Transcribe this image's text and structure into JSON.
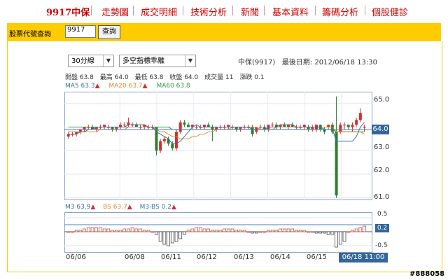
{
  "nav": {
    "items": [
      "9917中保",
      "走勢圖",
      "成交明細",
      "技術分析",
      "新聞",
      "基本資料",
      "籌碼分析",
      "個股健診"
    ]
  },
  "query": {
    "label": "股票代號查詢",
    "value": "9917",
    "button": "查詢"
  },
  "selectors": {
    "period": "30分線",
    "indicator": "多空指標乖離"
  },
  "stock": {
    "name_code": "中保(9917)",
    "last_date_label": "最後日期:",
    "last_date": "2012/06/18 13:30"
  },
  "quote": {
    "open": "開盤 63.8",
    "high": "最高 64.0",
    "low": "最低 63.8",
    "close": "收盤 64.0",
    "volume": "成交量 11",
    "change": "漲跌 0.1"
  },
  "ma": {
    "ma5": "MA5 63.3",
    "ma20": "MA20 63.7",
    "ma60": "MA60 63.8",
    "ma5_arrow": "▲",
    "ma20_arrow": "▲",
    "ma60_arrow": ""
  },
  "indicators": {
    "m3": "M3 63.9",
    "bs": "BS 63.7",
    "m3bs": "M3-BS 0.2",
    "m3_arrow": "▲",
    "bs_arrow": "▲",
    "m3bs_arrow": "▲"
  },
  "price_axis": [
    "65.0",
    "64.0",
    "63.0",
    "62.0",
    "61.0"
  ],
  "current_price": "64.0",
  "sub_axis": [
    "0.5",
    "0.2",
    "-0.5"
  ],
  "current_indicator": "0.2",
  "x_axis": [
    "06/06",
    "06/08",
    "06/11",
    "06/12",
    "06/13",
    "06/14",
    "06/15"
  ],
  "current_time": "06/18 11:00",
  "watermark": "#888058",
  "colors": {
    "up": "#d32f2f",
    "down": "#2e7d32",
    "ma5": "#3b6ea8",
    "ma20": "#e08a2c",
    "ma60": "#2e9a3e",
    "nav": "#cc0000",
    "bar": "#ffcc00"
  },
  "chart_data": {
    "type": "candlestick",
    "ylim": [
      60.9,
      65.5
    ],
    "candles": [
      [
        63.6,
        63.8,
        63.5,
        63.7
      ],
      [
        63.7,
        63.8,
        63.6,
        63.7
      ],
      [
        63.7,
        63.8,
        63.6,
        63.8
      ],
      [
        63.8,
        63.9,
        63.7,
        63.9
      ],
      [
        63.9,
        64.0,
        63.8,
        64.0
      ],
      [
        64.0,
        64.1,
        63.9,
        64.0
      ],
      [
        64.0,
        64.1,
        63.9,
        63.9
      ],
      [
        63.9,
        64.0,
        63.8,
        64.0
      ],
      [
        64.0,
        64.1,
        63.9,
        64.0
      ],
      [
        64.0,
        64.1,
        63.9,
        64.1
      ],
      [
        64.0,
        64.1,
        63.9,
        64.0
      ],
      [
        64.0,
        64.0,
        63.8,
        63.9
      ],
      [
        63.9,
        64.0,
        63.8,
        64.0
      ],
      [
        64.0,
        64.2,
        63.9,
        64.1
      ],
      [
        64.1,
        64.2,
        64.0,
        64.1
      ],
      [
        64.1,
        64.4,
        64.0,
        64.2
      ],
      [
        64.1,
        64.2,
        64.0,
        64.1
      ],
      [
        64.1,
        64.2,
        64.0,
        64.0
      ],
      [
        64.0,
        64.1,
        63.9,
        64.0
      ],
      [
        64.0,
        64.1,
        63.9,
        64.1
      ],
      [
        64.0,
        64.1,
        63.9,
        64.0
      ],
      [
        64.0,
        64.1,
        63.9,
        64.0
      ],
      [
        64.0,
        64.0,
        62.8,
        63.0
      ],
      [
        63.0,
        63.5,
        62.9,
        63.4
      ],
      [
        63.4,
        63.6,
        63.3,
        63.5
      ],
      [
        63.5,
        63.6,
        63.2,
        63.3
      ],
      [
        63.3,
        63.4,
        63.0,
        63.1
      ],
      [
        63.1,
        63.9,
        63.0,
        63.8
      ],
      [
        63.8,
        64.3,
        63.7,
        64.2
      ],
      [
        64.2,
        64.3,
        64.0,
        64.1
      ],
      [
        64.1,
        64.2,
        64.0,
        64.0
      ],
      [
        64.0,
        64.1,
        63.9,
        64.1
      ],
      [
        64.0,
        64.1,
        63.9,
        64.0
      ],
      [
        64.0,
        64.1,
        63.9,
        64.0
      ],
      [
        64.0,
        64.1,
        63.9,
        64.1
      ],
      [
        64.1,
        64.2,
        64.0,
        64.0
      ],
      [
        64.0,
        64.1,
        63.4,
        63.9
      ],
      [
        63.9,
        64.0,
        63.8,
        64.0
      ],
      [
        64.0,
        64.1,
        63.9,
        64.0
      ],
      [
        64.0,
        64.1,
        63.9,
        64.0
      ],
      [
        64.0,
        64.1,
        63.9,
        64.1
      ],
      [
        64.0,
        64.1,
        63.9,
        64.0
      ],
      [
        64.0,
        64.0,
        63.8,
        63.9
      ],
      [
        63.9,
        64.0,
        63.8,
        64.0
      ],
      [
        64.0,
        64.1,
        63.9,
        64.0
      ],
      [
        64.0,
        64.1,
        63.9,
        64.0
      ],
      [
        64.0,
        64.1,
        63.6,
        63.7
      ],
      [
        63.8,
        64.0,
        63.7,
        64.0
      ],
      [
        64.0,
        64.1,
        63.9,
        64.0
      ],
      [
        64.0,
        64.1,
        63.8,
        63.9
      ],
      [
        63.9,
        64.1,
        63.8,
        64.1
      ],
      [
        64.1,
        64.2,
        64.0,
        64.1
      ],
      [
        64.1,
        64.2,
        63.9,
        64.0
      ],
      [
        64.0,
        64.1,
        63.9,
        64.1
      ],
      [
        64.1,
        64.2,
        64.0,
        64.0
      ],
      [
        64.0,
        64.1,
        63.9,
        64.1
      ],
      [
        64.1,
        64.2,
        64.0,
        64.0
      ],
      [
        64.0,
        64.1,
        63.9,
        64.0
      ],
      [
        64.0,
        64.1,
        63.9,
        64.0
      ],
      [
        64.0,
        64.1,
        63.9,
        64.1
      ],
      [
        64.0,
        64.1,
        63.8,
        63.9
      ],
      [
        63.9,
        64.1,
        63.8,
        64.0
      ],
      [
        63.9,
        64.1,
        63.8,
        64.1
      ],
      [
        64.1,
        64.1,
        63.8,
        63.9
      ],
      [
        63.9,
        64.0,
        63.7,
        63.8
      ],
      [
        64.0,
        64.1,
        63.9,
        64.1
      ],
      [
        64.1,
        64.2,
        63.7,
        63.8
      ],
      [
        63.8,
        65.3,
        61.0,
        61.1
      ],
      [
        63.8,
        64.2,
        63.7,
        64.1
      ],
      [
        64.1,
        64.2,
        63.9,
        64.1
      ],
      [
        64.1,
        64.1,
        63.9,
        64.0
      ],
      [
        64.0,
        64.2,
        63.8,
        64.1
      ],
      [
        64.1,
        64.4,
        64.0,
        64.3
      ],
      [
        64.3,
        64.8,
        64.2,
        64.6
      ],
      [
        64.0,
        64.1,
        63.8,
        64.0
      ]
    ],
    "ma5": [
      63.7,
      63.7,
      63.7,
      63.8,
      63.8,
      63.9,
      63.9,
      64.0,
      64.0,
      64.0,
      64.0,
      64.0,
      64.0,
      64.0,
      64.0,
      64.1,
      64.1,
      64.1,
      64.1,
      64.1,
      64.0,
      64.0,
      63.8,
      63.7,
      63.6,
      63.5,
      63.3,
      63.3,
      63.4,
      63.6,
      63.8,
      64.0,
      64.1,
      64.0,
      64.0,
      64.0,
      64.0,
      64.0,
      64.0,
      64.0,
      64.0,
      64.0,
      64.0,
      64.0,
      64.0,
      64.0,
      63.9,
      63.9,
      63.9,
      63.9,
      64.0,
      64.0,
      64.0,
      64.1,
      64.1,
      64.1,
      64.1,
      64.0,
      64.0,
      64.0,
      64.0,
      64.0,
      64.0,
      64.0,
      63.9,
      63.9,
      63.9,
      63.4,
      63.4,
      63.4,
      63.4,
      63.4,
      63.6,
      64.0,
      64.2
    ],
    "ma20": [
      63.8,
      63.8,
      63.8,
      63.8,
      63.8,
      63.8,
      63.8,
      63.8,
      63.9,
      63.9,
      63.9,
      63.9,
      63.9,
      63.9,
      63.9,
      64.0,
      64.0,
      64.0,
      64.0,
      64.0,
      64.0,
      64.0,
      63.9,
      63.8,
      63.8,
      63.7,
      63.6,
      63.6,
      63.5,
      63.5,
      63.5,
      63.6,
      63.6,
      63.7,
      63.7,
      63.8,
      63.8,
      63.9,
      63.9,
      63.9,
      63.9,
      64.0,
      64.0,
      64.0,
      64.0,
      64.0,
      64.0,
      64.0,
      63.9,
      63.9,
      63.9,
      63.9,
      64.0,
      64.0,
      64.0,
      64.0,
      64.0,
      64.0,
      64.0,
      64.0,
      64.0,
      64.0,
      64.0,
      64.0,
      64.0,
      64.0,
      64.0,
      63.8,
      63.8,
      63.8,
      63.8,
      63.8,
      63.8,
      63.8,
      63.7
    ],
    "ma60": [
      64.0,
      64.0,
      64.0,
      64.0,
      64.0,
      64.0,
      64.0,
      64.0,
      64.0,
      64.0,
      64.0,
      64.0,
      64.0,
      64.0,
      64.0,
      64.0,
      64.0,
      64.0,
      64.0,
      64.0,
      64.0,
      64.0,
      64.0,
      64.0,
      64.0,
      64.0,
      63.9,
      63.9,
      63.9,
      63.9,
      63.9,
      63.9,
      63.9,
      63.9,
      63.9,
      63.9,
      63.9,
      63.9,
      63.9,
      63.9,
      63.9,
      63.9,
      63.9,
      63.9,
      63.9,
      63.9,
      63.9,
      63.9,
      63.9,
      63.9,
      63.9,
      63.9,
      63.9,
      63.9,
      63.9,
      63.9,
      63.9,
      63.9,
      63.9,
      63.9,
      63.9,
      63.9,
      63.9,
      63.9,
      63.9,
      63.9,
      63.9,
      63.8,
      63.8,
      63.8,
      63.8,
      63.8,
      63.8,
      63.8,
      63.8
    ],
    "m3bs": [
      0.0,
      0.0,
      0.05,
      0.05,
      0.1,
      0.15,
      0.15,
      0.15,
      0.15,
      0.1,
      0.1,
      0.05,
      0.05,
      0.05,
      0.1,
      0.1,
      0.15,
      0.1,
      0.1,
      0.05,
      0.05,
      0.0,
      -0.1,
      -0.35,
      -0.45,
      -0.5,
      -0.4,
      -0.35,
      -0.25,
      -0.1,
      0.05,
      0.1,
      0.15,
      0.15,
      0.1,
      0.1,
      0.05,
      0.05,
      0.05,
      0.1,
      0.1,
      0.1,
      0.05,
      0.05,
      0.05,
      0.0,
      -0.05,
      -0.05,
      0.0,
      0.0,
      0.05,
      0.05,
      0.05,
      0.1,
      0.1,
      0.1,
      0.1,
      0.05,
      0.05,
      0.05,
      0.0,
      0.0,
      -0.05,
      -0.05,
      -0.05,
      -0.1,
      -0.1,
      -0.55,
      -0.45,
      -0.35,
      0.0,
      0.05,
      0.1,
      0.15,
      0.2
    ]
  }
}
